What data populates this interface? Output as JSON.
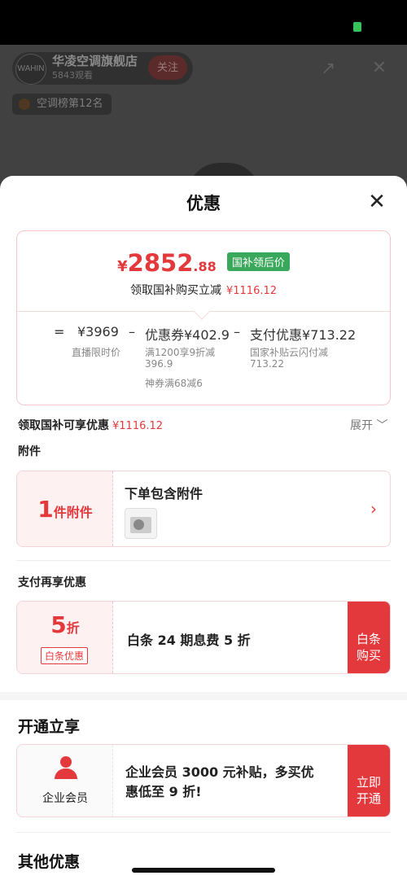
{
  "background": {
    "store_name": "华凌空调旗舰店",
    "viewers": "5843观看",
    "follow_label": "关注",
    "rank_label": "空调榜第12名",
    "avatar_text": "WAHIN"
  },
  "sheet": {
    "title": "优惠",
    "close_symbol": "✕"
  },
  "price": {
    "currency": "¥",
    "integer": "2852",
    "decimal": ".88",
    "tag": "国补领后价",
    "gov_label": "领取国补购买立减",
    "gov_amount": "¥1116.12"
  },
  "calc": {
    "equals": "=",
    "base_price": "¥3969",
    "base_note": "直播限时价",
    "minus1": "–",
    "coupon": "优惠券¥402.9",
    "coupon_note1": "满1200享9折减",
    "coupon_note1b": "396.9",
    "coupon_note2": "神券满68减6",
    "minus2": "–",
    "pay_discount": "支付优惠¥713.22",
    "pay_note": "国家补贴云闪付减",
    "pay_note_b": "713.22"
  },
  "summary": {
    "label": "领取国补可享优惠",
    "amount": "¥1116.12",
    "expand": "展开 ﹀"
  },
  "attachments": {
    "section": "附件",
    "count": "1",
    "count_suffix": "件附件",
    "title": "下单包含附件",
    "chevron": "›"
  },
  "payment": {
    "section": "支付再享优惠",
    "discount_num": "5",
    "discount_unit": "折",
    "badge": "白条优惠",
    "text": "白条 24 期息费 5 折",
    "button_line1": "白条",
    "button_line2": "购买"
  },
  "open": {
    "section": "开通立享",
    "member_label": "企业会员",
    "text_line1": "企业会员 3000 元补贴，多买优",
    "text_line2": "惠低至 9 折!",
    "button_line1": "立即",
    "button_line2": "开通"
  },
  "other": {
    "section": "其他优惠"
  },
  "colors": {
    "accent": "#e4393c",
    "tag_green": "#3aa85a"
  }
}
